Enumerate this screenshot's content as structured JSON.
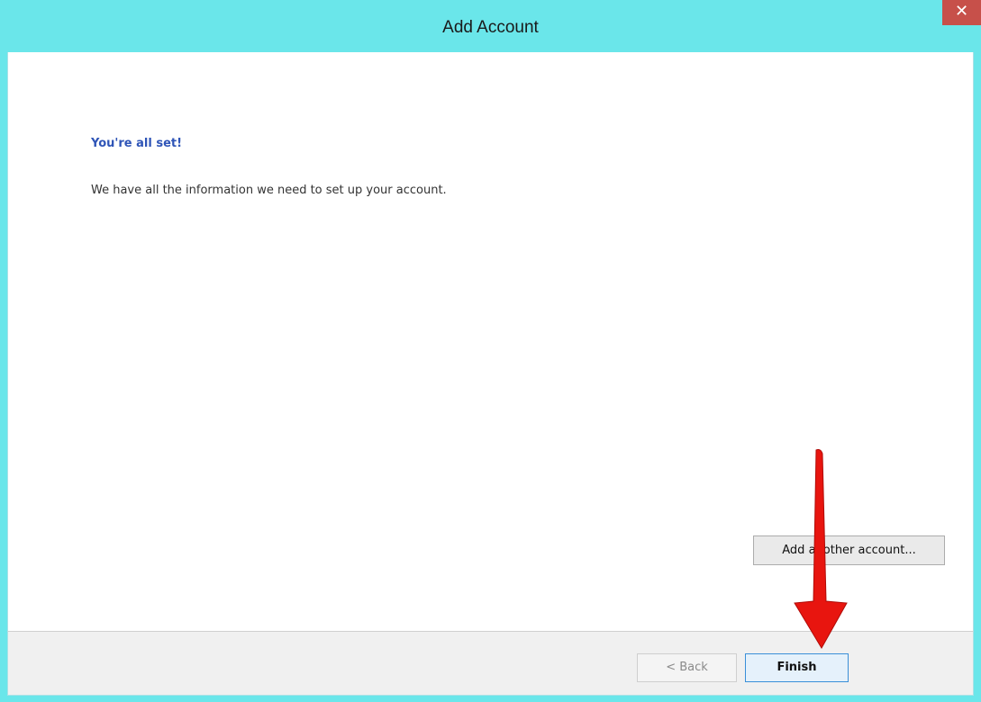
{
  "window": {
    "title": "Add Account",
    "close_glyph": "✕"
  },
  "content": {
    "heading": "You're all set!",
    "description": "We have all the information we need to set up your account.",
    "add_another_label": "Add another account..."
  },
  "footer": {
    "back_label": "< Back",
    "finish_label": "Finish"
  },
  "colors": {
    "titlebar": "#6ae6ea",
    "close_button": "#c7504a",
    "heading": "#2f55b7",
    "arrow": "#e8150f"
  },
  "icons": {
    "close": "close-icon",
    "annotation": "red-arrow-icon"
  }
}
